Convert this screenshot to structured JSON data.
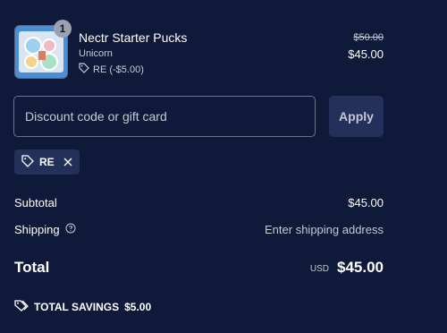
{
  "line_item": {
    "quantity": "1",
    "name": "Nectr Starter Pucks",
    "variant": "Unicorn",
    "discount_applied": "RE (-$5.00)",
    "original_price": "$50.00",
    "price": "$45.00"
  },
  "discount": {
    "placeholder": "Discount code or gift card",
    "apply_label": "Apply",
    "applied_code": "RE"
  },
  "summary": {
    "subtotal_label": "Subtotal",
    "subtotal_value": "$45.00",
    "shipping_label": "Shipping",
    "shipping_value": "Enter shipping address",
    "total_label": "Total",
    "currency": "USD",
    "total_value": "$45.00",
    "savings_label": "TOTAL SAVINGS",
    "savings_value": "$5.00"
  },
  "icons": {
    "tag": "tag-icon",
    "close": "close-icon",
    "help": "question-circle-icon",
    "savings": "tags-icon"
  },
  "colors": {
    "background": "#0f1a3a",
    "button_bg": "#22305a",
    "muted_text": "#c4c9d4"
  }
}
